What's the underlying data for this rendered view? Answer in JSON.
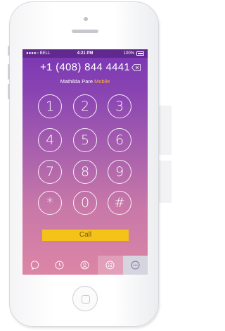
{
  "status_bar": {
    "carrier": "BELL",
    "time": "4:21 PM",
    "battery": "100%"
  },
  "dialer": {
    "phone_number": "+1 (408) 844 4441",
    "contact_name": "Mathilda Pare",
    "contact_label": "Mobile",
    "keys": [
      "1",
      "2",
      "3",
      "4",
      "5",
      "6",
      "7",
      "8",
      "9",
      "*",
      "0",
      "#"
    ],
    "call_label": "Call"
  },
  "tabs": [
    {
      "icon": "chat-bubble-icon"
    },
    {
      "icon": "clock-icon"
    },
    {
      "icon": "contact-icon"
    },
    {
      "icon": "keypad-icon"
    },
    {
      "icon": "more-icon"
    }
  ],
  "colors": {
    "gradient_top": "#7a36b4",
    "gradient_bottom": "#dc86a6",
    "call_button": "#f5c21a",
    "contact_label": "#ffb733"
  }
}
